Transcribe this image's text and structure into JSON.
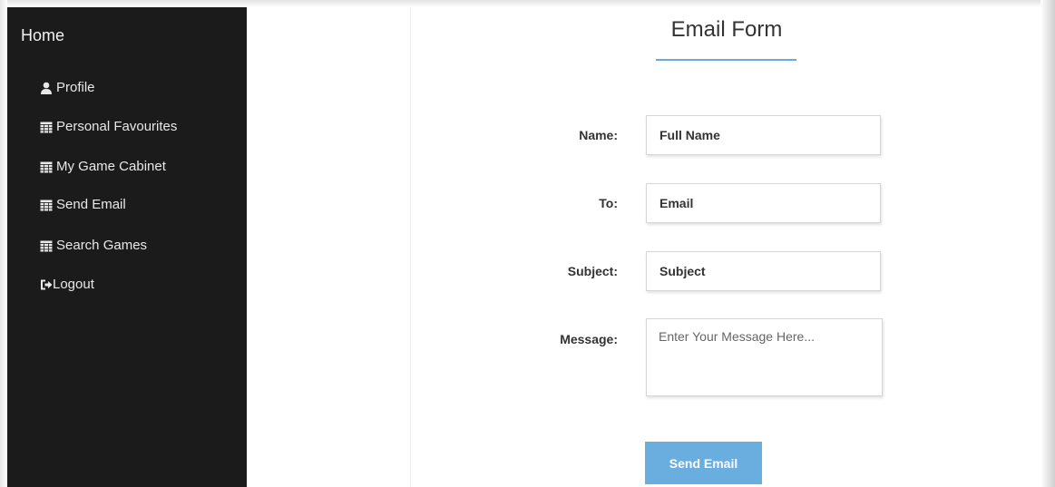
{
  "sidebar": {
    "title": "Home",
    "items": [
      {
        "label": "Profile",
        "icon": "user-icon"
      },
      {
        "label": "Personal Favourites",
        "icon": "calendar-icon"
      },
      {
        "label": "My Game Cabinet",
        "icon": "calendar-icon"
      },
      {
        "label": "Send Email",
        "icon": "calendar-icon"
      },
      {
        "label": "Search Games",
        "icon": "calendar-icon"
      },
      {
        "label": "Logout",
        "icon": "logout-icon"
      }
    ]
  },
  "form": {
    "title": "Email Form",
    "name_label": "Name:",
    "name_placeholder": "Full Name",
    "to_label": "To:",
    "to_placeholder": "Email",
    "subject_label": "Subject:",
    "subject_placeholder": "Subject",
    "message_label": "Message:",
    "message_placeholder": "Enter Your Message Here...",
    "submit_label": "Send Email"
  },
  "colors": {
    "sidebar_bg": "#1b1b1b",
    "accent": "#6aaee0",
    "underline": "#6aa9e0"
  }
}
